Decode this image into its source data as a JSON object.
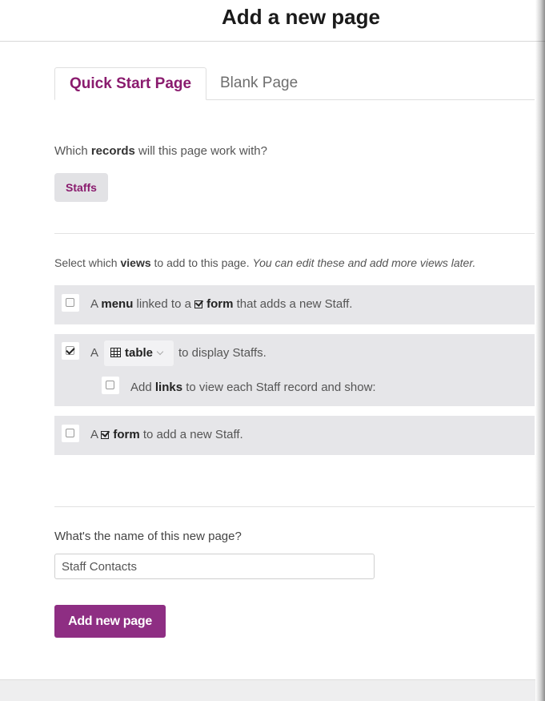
{
  "header": {
    "title": "Add a new page"
  },
  "tabs": [
    {
      "label": "Quick Start Page",
      "active": true
    },
    {
      "label": "Blank Page",
      "active": false
    }
  ],
  "records": {
    "question_prefix": "Which ",
    "question_bold": "records",
    "question_suffix": " will this page work with?",
    "selected": "Staffs"
  },
  "views": {
    "intro_prefix": "Select which ",
    "intro_bold": "views",
    "intro_mid": " to add to this page. ",
    "intro_italic": "You can edit these and add more views later.",
    "menu_option": {
      "checked": false,
      "a": "A ",
      "bold1": "menu",
      "mid": " linked to a ",
      "icon": "form-check-icon",
      "bold2": "form",
      "suffix": " that adds a new Staff."
    },
    "table_option": {
      "checked": true,
      "a": "A",
      "icon": "table-grid-icon",
      "dropdown_value": "table",
      "suffix": "to display Staffs.",
      "links": {
        "checked": false,
        "prefix": "Add ",
        "bold": "links",
        "suffix": " to view each Staff record and show:"
      }
    },
    "form_option": {
      "checked": false,
      "a": "A ",
      "icon": "form-check-icon",
      "bold": "form",
      "suffix": " to add a new Staff."
    }
  },
  "page_name": {
    "label": "What's the name of this new page?",
    "value": "Staff Contacts"
  },
  "submit": {
    "label": "Add new page"
  },
  "colors": {
    "accent": "#8a1b6e",
    "button": "#8e2e83",
    "row_bg": "#e6e6e9"
  }
}
